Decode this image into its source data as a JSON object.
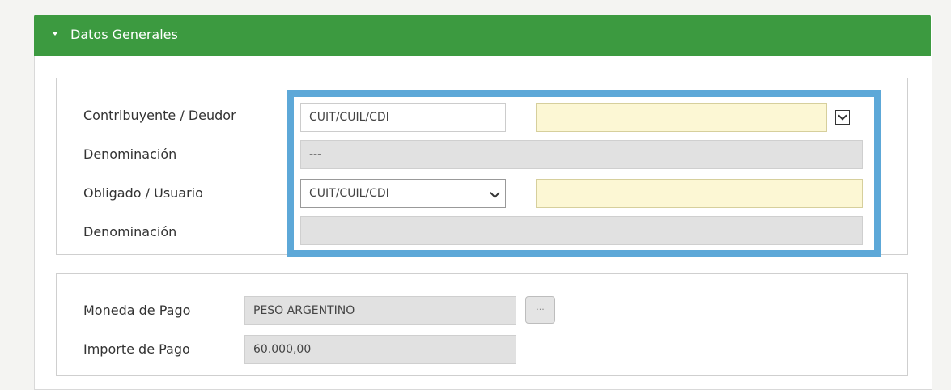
{
  "panel": {
    "title": "Datos Generales"
  },
  "section1": {
    "contribuyente_label": "Contribuyente / Deudor",
    "contribuyente_type_value": "CUIT/CUIL/CDI",
    "contribuyente_number_value": "",
    "denominacion1_label": "Denominación",
    "denominacion1_value": "---",
    "obligado_label": "Obligado / Usuario",
    "obligado_type_value": "CUIT/CUIL/CDI",
    "obligado_number_value": "",
    "denominacion2_label": "Denominación",
    "denominacion2_value": ""
  },
  "section2": {
    "moneda_label": "Moneda de Pago",
    "moneda_value": "PESO ARGENTINO",
    "moneda_button_label": "...",
    "importe_label": "Importe de Pago",
    "importe_value": "60.000,00"
  },
  "colors": {
    "header_green": "#3c9a40",
    "highlight_blue": "#5da8d8",
    "required_yellow": "#fcf7d4",
    "disabled_gray": "#e1e1e1"
  },
  "icons": {
    "header_toggle": "caret-down-icon",
    "dropdown": "chevron-down-icon"
  }
}
